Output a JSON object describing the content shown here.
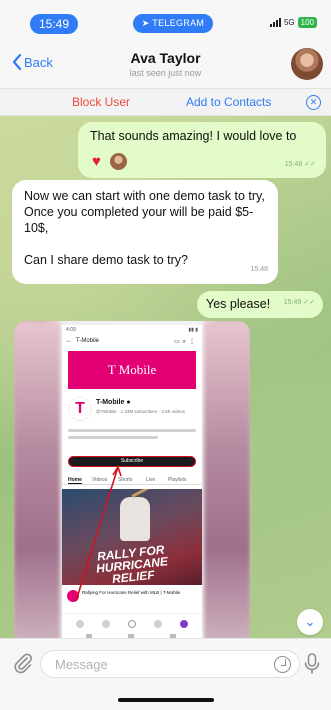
{
  "status_bar": {
    "time": "15:49",
    "app_pill": "TELEGRAM",
    "network": "5G",
    "battery": "100"
  },
  "header": {
    "back_label": "Back",
    "contact_name": "Ava Taylor",
    "last_seen": "last seen just now"
  },
  "action_bar": {
    "block_label": "Block User",
    "add_label": "Add to Contacts"
  },
  "messages": [
    {
      "direction": "outgoing",
      "text": "That sounds amazing! I would love to",
      "reaction": "heart",
      "time": "15:48"
    },
    {
      "direction": "incoming",
      "text": "Now we can start with one demo task to try, Once you completed your will be paid $5-10$,\n\nCan I share demo task to try?",
      "time": "15:48"
    },
    {
      "direction": "outgoing",
      "text": "Yes please!",
      "time": "15:49"
    }
  ],
  "image_message": {
    "phone_time": "4:09",
    "channel_nav_title": "T-Mobile",
    "banner_text": "T Mobile",
    "channel_name": "T-Mobile",
    "channel_meta": "@TMobile · 1.33M subscribers · 3.6K videos",
    "subscribe_label": "Subscribe",
    "tabs": [
      "Home",
      "Videos",
      "Shorts",
      "Live",
      "Playlists"
    ],
    "video_overlay": "RALLY FOR HURRICANE RELIEF",
    "video_title": "Rallying For Hurricane Relief with MLB | T-Mobile"
  },
  "composer": {
    "placeholder": "Message"
  },
  "colors": {
    "accent": "#2f7cf6",
    "danger": "#f0483b",
    "outgoing_bubble": "#e2fbc9",
    "brand_magenta": "#e20074"
  }
}
